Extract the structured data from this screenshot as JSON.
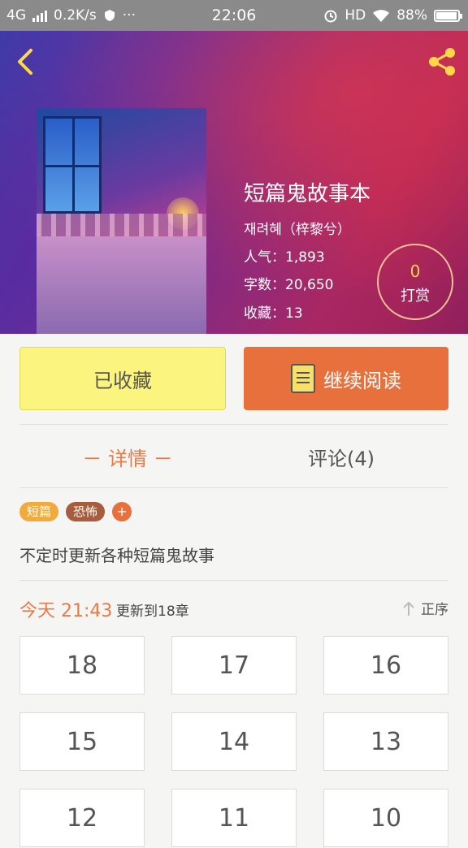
{
  "status_bar": {
    "network": "4G",
    "speed": "0.2K/s",
    "dots": "···",
    "time": "22:06",
    "hd": "HD",
    "battery": "88%"
  },
  "book": {
    "title": "短篇鬼故事本",
    "author": "재려혜（梓黎兮）",
    "popularity": "人气：1,893",
    "word_count": "字数：20,650",
    "favorites": "收藏：13"
  },
  "tip": {
    "count": "0",
    "label": "打赏"
  },
  "actions": {
    "favorited": "已收藏",
    "continue_reading": "继续阅读"
  },
  "tabs": {
    "detail": "－ 详情 －",
    "comments": "评论(4)"
  },
  "tags": [
    "短篇",
    "恐怖"
  ],
  "tag_add": "+",
  "description": "不定时更新各种短篇鬼故事",
  "update": {
    "time": "今天 21:43",
    "text": "更新到18章",
    "sort": "正序"
  },
  "chapters": [
    "18",
    "17",
    "16",
    "15",
    "14",
    "13",
    "12",
    "11",
    "10"
  ],
  "icons": {
    "back": "chevron-left-icon",
    "share": "share-icon",
    "book": "book-icon",
    "sort": "arrow-up-icon"
  },
  "colors": {
    "accent": "#ea7a45",
    "favorite_button": "#fbf47f",
    "read_button": "#e8703d",
    "tip_count": "#ffd34d"
  }
}
